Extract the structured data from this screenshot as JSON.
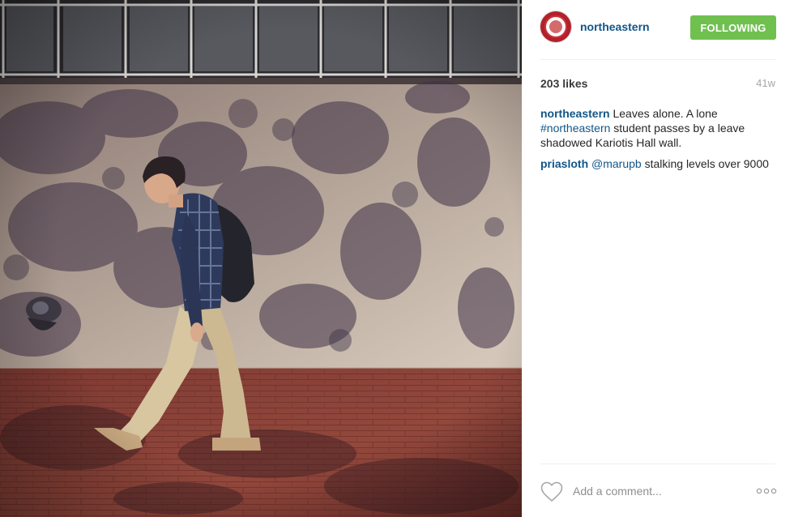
{
  "post": {
    "photo_alt": "",
    "author": {
      "username": "northeastern",
      "follow_label": "FOLLOWING"
    },
    "likes": "203 likes",
    "age": "41w",
    "caption": {
      "author": "northeastern",
      "text_1": " Leaves alone. A lone ",
      "hashtag": "#northeastern",
      "text_2": " student passes by a leave shadowed Kariotis Hall wall."
    },
    "comments": [
      {
        "author": "priasloth",
        "mention": "@marupb",
        "text": " stalking levels over 9000"
      }
    ],
    "add_comment_placeholder": "Add a comment...",
    "icons": {
      "like": "heart-outline-icon",
      "more": "more-options-icon"
    },
    "colors": {
      "follow_button": "#70c050",
      "link": "#125688",
      "avatar_ring": "#b3202a"
    }
  }
}
